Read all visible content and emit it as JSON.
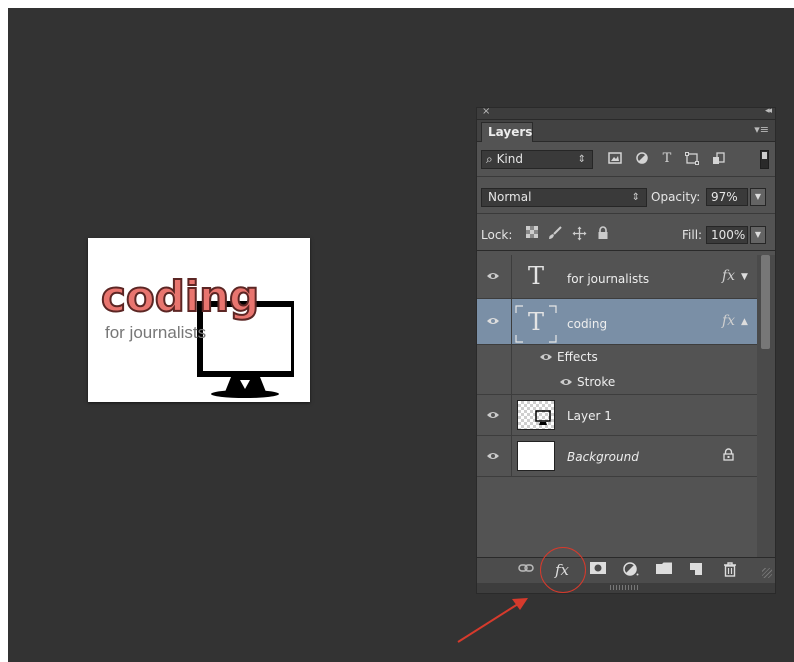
{
  "document": {
    "headline": "coding",
    "subtitle": "for journalists"
  },
  "panel": {
    "title": "Layers",
    "close_glyph": "×",
    "collapse_glyph": "◂◂",
    "menu_glyph": "▾≡",
    "filter": {
      "kind_label": "Kind",
      "search_glyph": "⌕",
      "arrows": "⇕"
    },
    "blend": {
      "mode": "Normal",
      "opacity_label": "Opacity:",
      "opacity_value": "97%"
    },
    "lock": {
      "label": "Lock:",
      "fill_label": "Fill:",
      "fill_value": "100%"
    },
    "layers": [
      {
        "name": "for journalists",
        "type": "text",
        "fx": "fx",
        "selected": false
      },
      {
        "name": "coding",
        "type": "text",
        "fx": "fx",
        "selected": true
      },
      {
        "name": "Layer 1",
        "type": "image"
      },
      {
        "name": "Background",
        "type": "image",
        "locked": true
      }
    ],
    "effects": {
      "header": "Effects",
      "stroke": "Stroke"
    },
    "glyphs": {
      "eye": "👁",
      "text_thumb": "T",
      "lock": "🔒",
      "fx_toggle_up": "▲",
      "fx_toggle_down": "▼",
      "dropdown": "▾"
    },
    "bottom_icons": [
      "link-icon",
      "fx-icon",
      "mask-icon",
      "adjustment-icon",
      "folder-icon",
      "new-layer-icon",
      "trash-icon"
    ],
    "bottom_fx": "fx"
  },
  "colors": {
    "headline_fill": "#e8756f",
    "selection": "#7a8fa6",
    "annotation": "#d63a2c"
  }
}
